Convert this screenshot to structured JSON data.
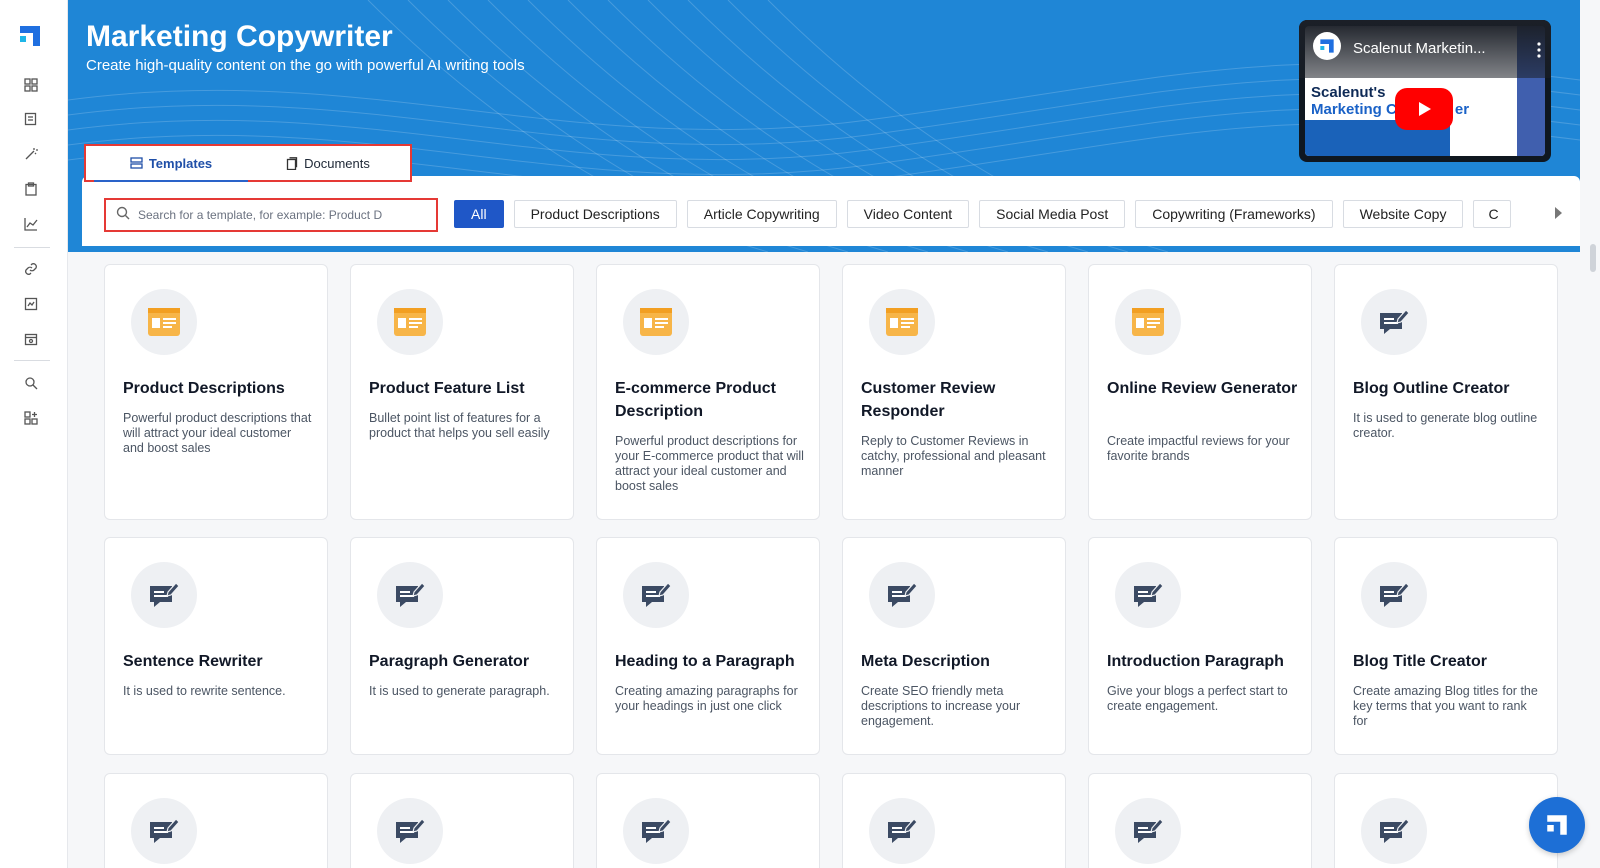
{
  "header": {
    "title": "Marketing Copywriter",
    "subtitle": "Create high-quality content on the go with powerful AI writing tools"
  },
  "video": {
    "title": "Scalenut Marketin...",
    "line1": "Scalenut's",
    "line2": "Marketing C",
    "line2_tail": "er"
  },
  "tabs": [
    {
      "label": "Templates",
      "active": true
    },
    {
      "label": "Documents",
      "active": false
    }
  ],
  "search": {
    "placeholder": "Search for a template, for example: Product D"
  },
  "categories": [
    {
      "label": "All",
      "active": true
    },
    {
      "label": "Product Descriptions"
    },
    {
      "label": "Article Copywriting"
    },
    {
      "label": "Video Content"
    },
    {
      "label": "Social Media Post"
    },
    {
      "label": "Copywriting (Frameworks)"
    },
    {
      "label": "Website Copy"
    },
    {
      "label": "C"
    }
  ],
  "cards": [
    {
      "title": "Product Descriptions",
      "desc": "Powerful product descriptions that will attract your ideal customer and boost sales",
      "icon": "browser-card-icon"
    },
    {
      "title": "Product Feature List",
      "desc": "Bullet point list of features for a product that helps you sell easily",
      "icon": "browser-card-icon"
    },
    {
      "title": "E-commerce Product Description",
      "desc": "Powerful product descriptions for your E-commerce product that will attract your ideal customer and boost sales",
      "icon": "browser-card-icon"
    },
    {
      "title": "Customer Review Responder",
      "desc": "Reply to Customer Reviews in catchy, professional and pleasant manner",
      "icon": "browser-card-icon"
    },
    {
      "title": "Online Review Generator",
      "desc": "Create impactful reviews for your favorite brands",
      "icon": "browser-card-icon"
    },
    {
      "title": "Blog Outline Creator",
      "desc": "It is used to generate blog outline creator.",
      "icon": "message-edit-icon"
    },
    {
      "title": "Sentence Rewriter",
      "desc": "It is used to rewrite sentence.",
      "icon": "message-edit-icon"
    },
    {
      "title": "Paragraph Generator",
      "desc": "It is used to generate paragraph.",
      "icon": "message-edit-icon"
    },
    {
      "title": "Heading to a Paragraph",
      "desc": "Creating amazing paragraphs for your headings in just one click",
      "icon": "message-edit-icon"
    },
    {
      "title": "Meta Description",
      "desc": "Create SEO friendly meta descriptions to increase your engagement.",
      "icon": "message-edit-icon"
    },
    {
      "title": "Introduction Paragraph",
      "desc": "Give your blogs a perfect start to create engagement.",
      "icon": "message-edit-icon"
    },
    {
      "title": "Blog Title Creator",
      "desc": "Create amazing Blog titles for the key terms that you want to rank for",
      "icon": "message-edit-icon"
    }
  ],
  "colors": {
    "banner": "#1f86d6",
    "accent": "#1f57c7",
    "highlight_border": "#e53935",
    "card_icon_orange": "#f7b548",
    "card_icon_navy": "#3b4a63"
  }
}
